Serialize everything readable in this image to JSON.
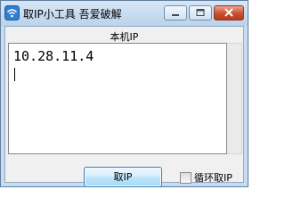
{
  "window": {
    "title": "取IP小工具 吾爱破解"
  },
  "main": {
    "section_label": "本机IP",
    "ip_value": "10.28.11.4",
    "get_ip_button_label": "取IP",
    "loop_checkbox_label": "循环取IP",
    "loop_checked": false
  }
}
